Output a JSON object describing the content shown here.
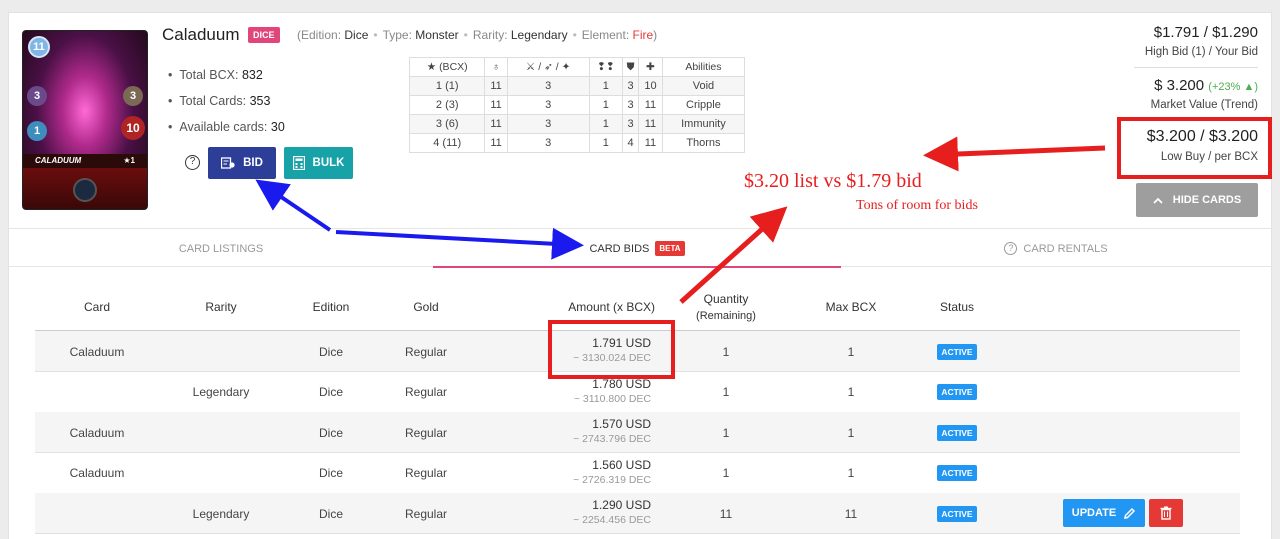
{
  "card": {
    "name": "Caladuum",
    "edition_badge": "DICE",
    "edition_label": "Edition:",
    "edition_value": "Dice",
    "type_label": "Type:",
    "type_value": "Monster",
    "rarity_label": "Rarity:",
    "rarity_value": "Legendary",
    "element_label": "Element:",
    "element_value": "Fire",
    "image": {
      "name_bar": "CALADUUM",
      "level": "★1",
      "mana": "11",
      "stat_left_1": "3",
      "stat_left_2": "1",
      "stat_right_1": "3",
      "stat_right_2": "10"
    }
  },
  "summary": {
    "total_bcx_label": "Total BCX:",
    "total_bcx": "832",
    "total_cards_label": "Total Cards:",
    "total_cards": "353",
    "available_label": "Available cards:",
    "available": "30"
  },
  "buttons": {
    "bid": "BID",
    "bulk": "BULK",
    "hide_cards": "HIDE CARDS",
    "update": "UPDATE"
  },
  "levels": {
    "headers": [
      "★ (BCX)",
      "♁",
      "⚔ / ➶ / ✦",
      "❢❢",
      "⛊",
      "✚",
      "Abilities"
    ],
    "rows": [
      [
        "1 (1)",
        "11",
        "3",
        "1",
        "3",
        "10",
        "Void"
      ],
      [
        "2 (3)",
        "11",
        "3",
        "1",
        "3",
        "11",
        "Cripple"
      ],
      [
        "3 (6)",
        "11",
        "3",
        "1",
        "3",
        "11",
        "Immunity"
      ],
      [
        "4 (11)",
        "11",
        "3",
        "1",
        "4",
        "11",
        "Thorns"
      ]
    ]
  },
  "prices": {
    "high_bid": "$1.791 / $1.290",
    "high_bid_label": "High Bid (1) / Your Bid",
    "market_value": "$ 3.200",
    "trend": "(+23% ▲)",
    "market_label": "Market Value (Trend)",
    "low_buy": "$3.200 / $3.200",
    "low_buy_label": "Low Buy / per BCX"
  },
  "tabs": {
    "listings": "CARD LISTINGS",
    "bids": "CARD BIDS",
    "beta": "BETA",
    "rentals": "CARD RENTALS"
  },
  "bids_table": {
    "headers": {
      "card": "Card",
      "rarity": "Rarity",
      "edition": "Edition",
      "gold": "Gold",
      "amount": "Amount (x BCX)",
      "quantity": "Quantity",
      "remaining": "(Remaining)",
      "max_bcx": "Max BCX",
      "status": "Status"
    },
    "rows": [
      {
        "card": "Caladuum",
        "rarity": "",
        "edition": "Dice",
        "gold": "Regular",
        "usd": "1.791 USD",
        "dec": "~ 3130.024 DEC",
        "qty": "1",
        "max": "1",
        "status": "ACTIVE"
      },
      {
        "card": "",
        "rarity": "Legendary",
        "edition": "Dice",
        "gold": "Regular",
        "usd": "1.780 USD",
        "dec": "~ 3110.800 DEC",
        "qty": "1",
        "max": "1",
        "status": "ACTIVE"
      },
      {
        "card": "Caladuum",
        "rarity": "",
        "edition": "Dice",
        "gold": "Regular",
        "usd": "1.570 USD",
        "dec": "~ 2743.796 DEC",
        "qty": "1",
        "max": "1",
        "status": "ACTIVE"
      },
      {
        "card": "Caladuum",
        "rarity": "",
        "edition": "Dice",
        "gold": "Regular",
        "usd": "1.560 USD",
        "dec": "~ 2726.319 DEC",
        "qty": "1",
        "max": "1",
        "status": "ACTIVE"
      },
      {
        "card": "",
        "rarity": "Legendary",
        "edition": "Dice",
        "gold": "Regular",
        "usd": "1.290 USD",
        "dec": "~ 2254.456 DEC",
        "qty": "11",
        "max": "11",
        "status": "ACTIVE"
      }
    ]
  },
  "annotations": {
    "line1": "$3.20 list vs $1.79 bid",
    "line2": "Tons of room for bids"
  },
  "colors": {
    "annotation_red": "#e61e1e",
    "annotation_blue": "#1a1aee",
    "bid_button": "#2c3e98",
    "bulk_button": "#17a2a8",
    "active_badge": "#2196f3",
    "dice_badge": "#e0457b"
  }
}
